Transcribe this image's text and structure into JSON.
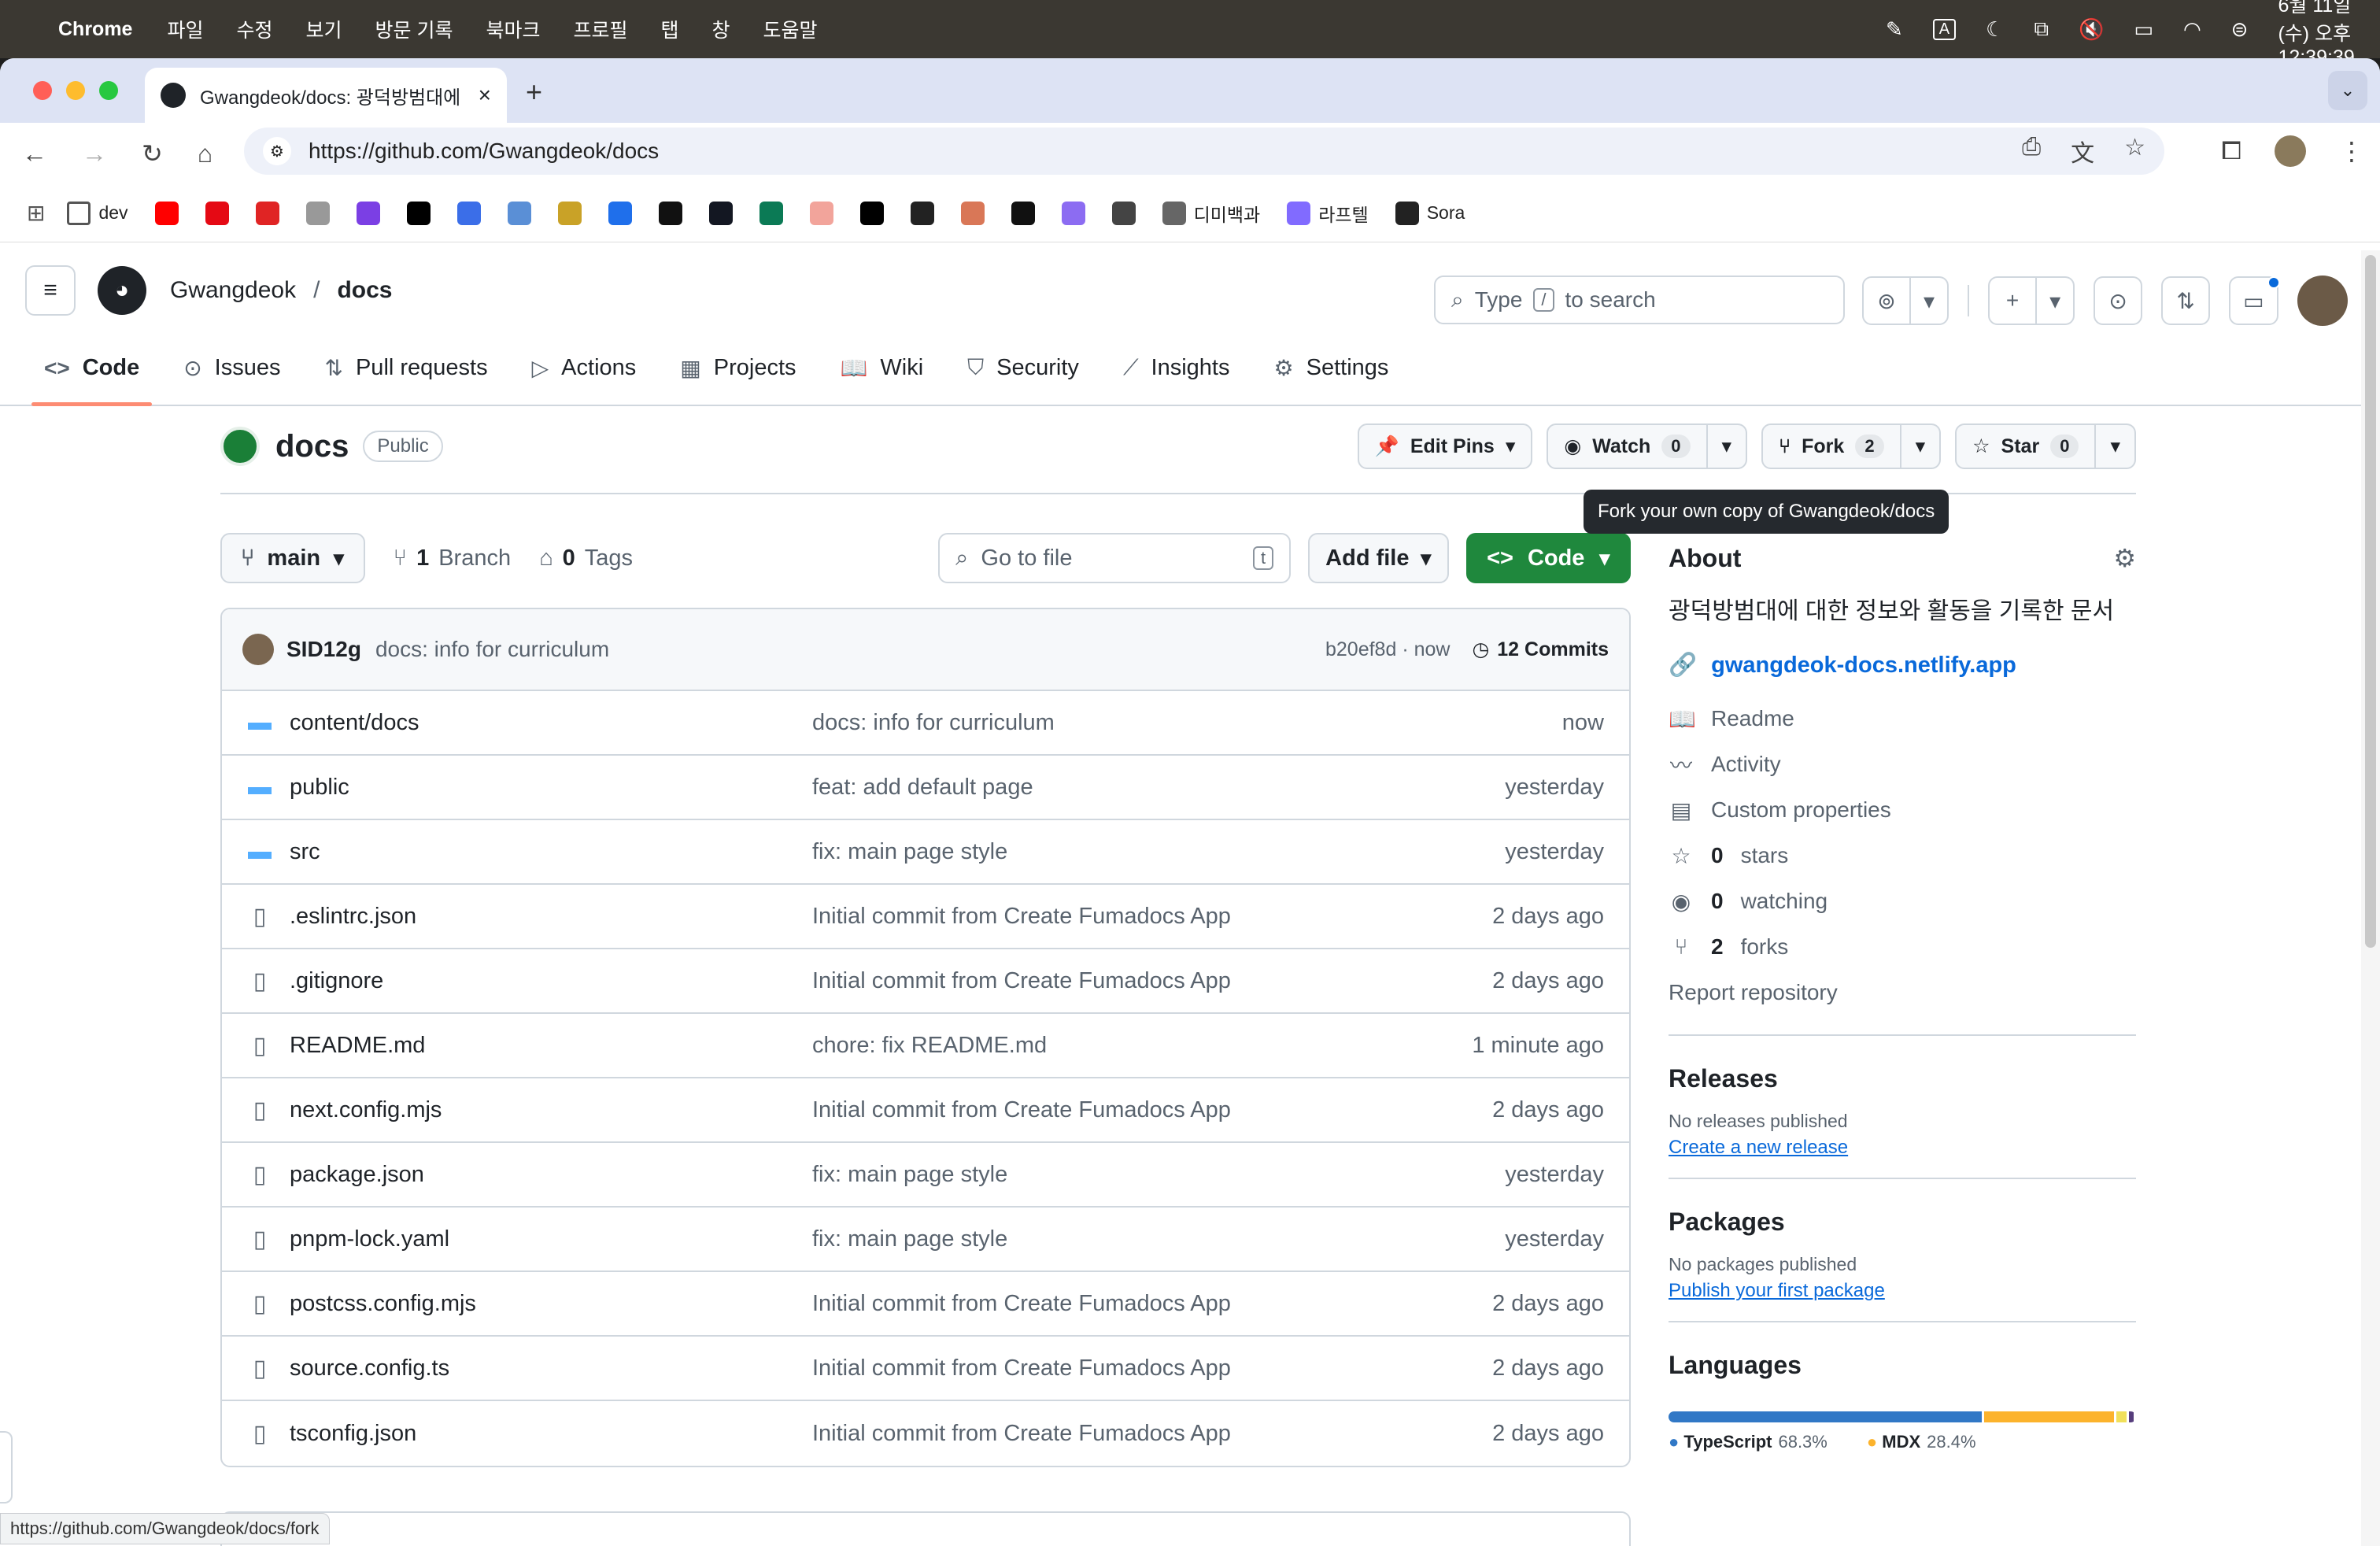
{
  "menubar": {
    "app": "Chrome",
    "items": [
      "파일",
      "수정",
      "보기",
      "방문 기록",
      "북마크",
      "프로필",
      "탭",
      "창",
      "도움말"
    ],
    "clock": "6월 11일 (수) 오후 12:39:39"
  },
  "browser": {
    "tab_title": "Gwangdeok/docs: 광덕방범대에",
    "url": "https://github.com/Gwangdeok/docs",
    "bookmarks": [
      {
        "label": "dev",
        "color": "#555555"
      },
      {
        "label": "",
        "color": "#ff0000"
      },
      {
        "label": "",
        "color": "#e50914"
      },
      {
        "label": "",
        "color": "#e02424"
      },
      {
        "label": "",
        "color": "#999999"
      },
      {
        "label": "",
        "color": "#7b3fe4"
      },
      {
        "label": "",
        "color": "#000000"
      },
      {
        "label": "",
        "color": "#3b6ee8"
      },
      {
        "label": "",
        "color": "#5a8fd6"
      },
      {
        "label": "",
        "color": "#c9a227"
      },
      {
        "label": "",
        "color": "#1f6feb"
      },
      {
        "label": "",
        "color": "#111111"
      },
      {
        "label": "",
        "color": "#131722"
      },
      {
        "label": "",
        "color": "#0b7a55"
      },
      {
        "label": "",
        "color": "#f2a49b"
      },
      {
        "label": "",
        "color": "#000000"
      },
      {
        "label": "",
        "color": "#222222"
      },
      {
        "label": "",
        "color": "#d97757"
      },
      {
        "label": "",
        "color": "#111111"
      },
      {
        "label": "",
        "color": "#8c6cf2"
      },
      {
        "label": "",
        "color": "#444444"
      },
      {
        "label": "디미백과",
        "color": "#666666"
      },
      {
        "label": "라프텔",
        "color": "#816bff"
      },
      {
        "label": "Sora",
        "color": "#222222"
      }
    ],
    "status_url": "https://github.com/Gwangdeok/docs/fork"
  },
  "header": {
    "owner": "Gwangdeok",
    "separator": "/",
    "repo": "docs",
    "search_prefix": "Type",
    "search_key": "/",
    "search_suffix": "to search"
  },
  "repo_nav": [
    {
      "label": "Code",
      "icon": "<>",
      "active": true
    },
    {
      "label": "Issues",
      "icon": "⊙"
    },
    {
      "label": "Pull requests",
      "icon": "⇅"
    },
    {
      "label": "Actions",
      "icon": "▷"
    },
    {
      "label": "Projects",
      "icon": "▦"
    },
    {
      "label": "Wiki",
      "icon": "📖"
    },
    {
      "label": "Security",
      "icon": "⛉"
    },
    {
      "label": "Insights",
      "icon": "⟋"
    },
    {
      "label": "Settings",
      "icon": "⚙"
    }
  ],
  "repo": {
    "name": "docs",
    "visibility": "Public",
    "edit_pins": "Edit Pins",
    "watch": "Watch",
    "watch_count": "0",
    "fork": "Fork",
    "fork_count": "2",
    "star": "Star",
    "star_count": "0",
    "tooltip": "Fork your own copy of Gwangdeok/docs"
  },
  "filebar": {
    "branch": "main",
    "branches_count": "1",
    "branches_label": "Branch",
    "tags_count": "0",
    "tags_label": "Tags",
    "goto_placeholder": "Go to file",
    "goto_key": "t",
    "add_file": "Add file",
    "code": "Code"
  },
  "last_commit": {
    "author": "SID12g",
    "message": "docs: info for curriculum",
    "hash": "b20ef8d · now",
    "commits_label": "12 Commits"
  },
  "files": [
    {
      "name": "content/docs",
      "type": "dir",
      "message": "docs: info for curriculum",
      "time": "now"
    },
    {
      "name": "public",
      "type": "dir",
      "message": "feat: add default page",
      "time": "yesterday"
    },
    {
      "name": "src",
      "type": "dir",
      "message": "fix: main page style",
      "time": "yesterday"
    },
    {
      "name": ".eslintrc.json",
      "type": "file",
      "message": "Initial commit from Create Fumadocs App",
      "time": "2 days ago"
    },
    {
      "name": ".gitignore",
      "type": "file",
      "message": "Initial commit from Create Fumadocs App",
      "time": "2 days ago"
    },
    {
      "name": "README.md",
      "type": "file",
      "message": "chore: fix README.md",
      "time": "1 minute ago"
    },
    {
      "name": "next.config.mjs",
      "type": "file",
      "message": "Initial commit from Create Fumadocs App",
      "time": "2 days ago"
    },
    {
      "name": "package.json",
      "type": "file",
      "message": "fix: main page style",
      "time": "yesterday"
    },
    {
      "name": "pnpm-lock.yaml",
      "type": "file",
      "message": "fix: main page style",
      "time": "yesterday"
    },
    {
      "name": "postcss.config.mjs",
      "type": "file",
      "message": "Initial commit from Create Fumadocs App",
      "time": "2 days ago"
    },
    {
      "name": "source.config.ts",
      "type": "file",
      "message": "Initial commit from Create Fumadocs App",
      "time": "2 days ago"
    },
    {
      "name": "tsconfig.json",
      "type": "file",
      "message": "Initial commit from Create Fumadocs App",
      "time": "2 days ago"
    }
  ],
  "about": {
    "title": "About",
    "description": "광덕방범대에 대한 정보와 활동을 기록한 문서",
    "link": "gwangdeok-docs.netlify.app",
    "items": [
      {
        "icon": "📖",
        "bold": "",
        "text": "Readme"
      },
      {
        "icon": "〰",
        "bold": "",
        "text": "Activity"
      },
      {
        "icon": "▤",
        "bold": "",
        "text": "Custom properties"
      },
      {
        "icon": "☆",
        "bold": "0",
        "text": "stars"
      },
      {
        "icon": "◉",
        "bold": "0",
        "text": "watching"
      },
      {
        "icon": "⑂",
        "bold": "2",
        "text": "forks"
      }
    ],
    "report": "Report repository"
  },
  "releases": {
    "title": "Releases",
    "empty": "No releases published",
    "link": "Create a new release"
  },
  "packages": {
    "title": "Packages",
    "empty": "No packages published",
    "link": "Publish your first package"
  },
  "languages": {
    "title": "Languages",
    "items": [
      {
        "name": "TypeScript",
        "percent": "68.3%",
        "share": 68.3,
        "color": "#3178c6"
      },
      {
        "name": "MDX",
        "percent": "28.4%",
        "share": 28.4,
        "color": "#fcb32c"
      },
      {
        "name": "",
        "percent": "",
        "share": 2.3,
        "color": "#f1e05a"
      },
      {
        "name": "",
        "percent": "",
        "share": 1.0,
        "color": "#563d7c"
      }
    ]
  }
}
